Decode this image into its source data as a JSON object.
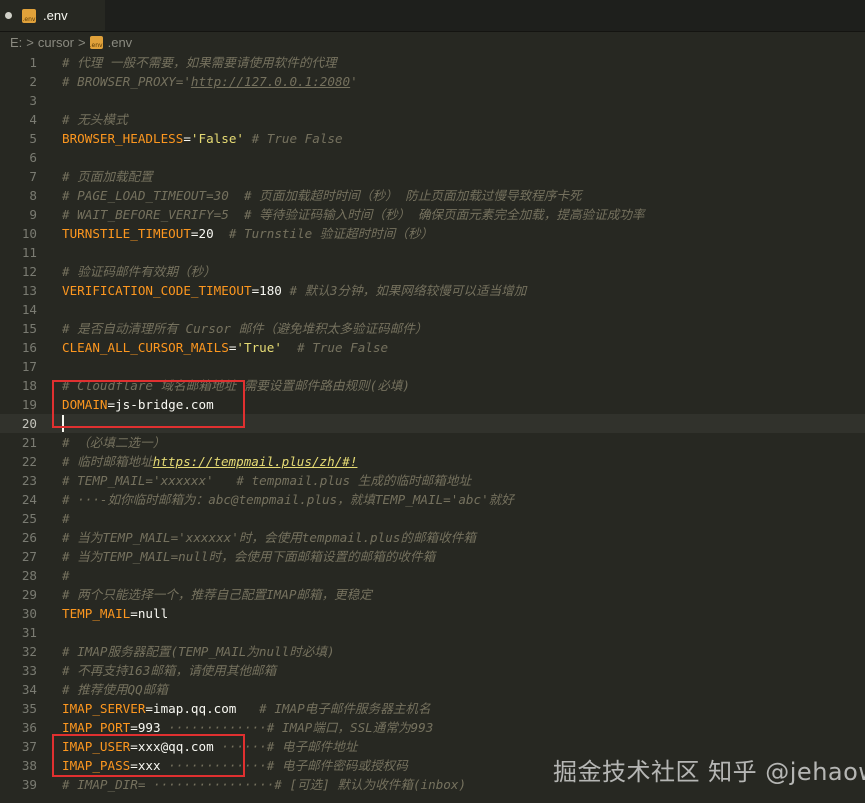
{
  "tab": {
    "label": ".env",
    "file_icon_text": ".env"
  },
  "breadcrumb": {
    "drive": "E:",
    "folder": "cursor",
    "file": ".env",
    "separator": ">"
  },
  "lines": [
    {
      "n": "1",
      "tokens": [
        {
          "t": "c",
          "v": "# 代理 一般不需要，如果需要请使用软件的代理"
        }
      ]
    },
    {
      "n": "2",
      "tokens": [
        {
          "t": "c",
          "v": "# BROWSER_PROXY='"
        },
        {
          "t": "u2",
          "v": "http://127.0.0.1:2080"
        },
        {
          "t": "c",
          "v": "'"
        }
      ]
    },
    {
      "n": "3",
      "tokens": []
    },
    {
      "n": "4",
      "tokens": [
        {
          "t": "c",
          "v": "# 无头模式"
        }
      ]
    },
    {
      "n": "5",
      "tokens": [
        {
          "t": "k",
          "v": "BROWSER_HEADLESS"
        },
        {
          "t": "o",
          "v": "="
        },
        {
          "t": "s",
          "v": "'False'"
        },
        {
          "t": "c",
          "v": " # True False"
        }
      ]
    },
    {
      "n": "6",
      "tokens": []
    },
    {
      "n": "7",
      "tokens": [
        {
          "t": "c",
          "v": "# 页面加载配置"
        }
      ]
    },
    {
      "n": "8",
      "tokens": [
        {
          "t": "c",
          "v": "# PAGE_LOAD_TIMEOUT=30  # 页面加载超时时间（秒） 防止页面加载过慢导致程序卡死"
        }
      ]
    },
    {
      "n": "9",
      "tokens": [
        {
          "t": "c",
          "v": "# WAIT_BEFORE_VERIFY=5  # 等待验证码输入时间（秒） 确保页面元素完全加载，提高验证成功率"
        }
      ]
    },
    {
      "n": "10",
      "tokens": [
        {
          "t": "k",
          "v": "TURNSTILE_TIMEOUT"
        },
        {
          "t": "o",
          "v": "=20"
        },
        {
          "t": "c",
          "v": "  # Turnstile 验证超时时间（秒）"
        }
      ]
    },
    {
      "n": "11",
      "tokens": []
    },
    {
      "n": "12",
      "tokens": [
        {
          "t": "c",
          "v": "# 验证码邮件有效期（秒）"
        }
      ]
    },
    {
      "n": "13",
      "tokens": [
        {
          "t": "k",
          "v": "VERIFICATION_CODE_TIMEOUT"
        },
        {
          "t": "o",
          "v": "=180"
        },
        {
          "t": "c",
          "v": " # 默认3分钟，如果网络较慢可以适当增加"
        }
      ]
    },
    {
      "n": "14",
      "tokens": []
    },
    {
      "n": "15",
      "tokens": [
        {
          "t": "c",
          "v": "# 是否自动清理所有 Cursor 邮件（避免堆积太多验证码邮件）"
        }
      ]
    },
    {
      "n": "16",
      "tokens": [
        {
          "t": "k",
          "v": "CLEAN_ALL_CURSOR_MAILS"
        },
        {
          "t": "o",
          "v": "="
        },
        {
          "t": "s",
          "v": "'True'"
        },
        {
          "t": "c",
          "v": "  # True False"
        }
      ]
    },
    {
      "n": "17",
      "tokens": []
    },
    {
      "n": "18",
      "tokens": [
        {
          "t": "c",
          "v": "# Cloudflare 域名邮箱地址 需要设置邮件路由规则(必填)"
        }
      ]
    },
    {
      "n": "19",
      "tokens": [
        {
          "t": "k",
          "v": "DOMAIN"
        },
        {
          "t": "o",
          "v": "=js-bridge.com"
        }
      ]
    },
    {
      "n": "20",
      "tokens": [],
      "active": true
    },
    {
      "n": "21",
      "tokens": [
        {
          "t": "c",
          "v": "# （必填二选一）"
        }
      ]
    },
    {
      "n": "22",
      "tokens": [
        {
          "t": "c",
          "v": "# 临时邮箱地址"
        },
        {
          "t": "u",
          "v": "https://tempmail.plus/zh/#!"
        }
      ]
    },
    {
      "n": "23",
      "tokens": [
        {
          "t": "c",
          "v": "# TEMP_MAIL='xxxxxx'   # tempmail.plus 生成的临时邮箱地址"
        }
      ]
    },
    {
      "n": "24",
      "tokens": [
        {
          "t": "c",
          "v": "# ···-如你临时邮箱为：abc@tempmail.plus，就填TEMP_MAIL='abc'就好"
        }
      ]
    },
    {
      "n": "25",
      "tokens": [
        {
          "t": "c",
          "v": "#"
        }
      ]
    },
    {
      "n": "26",
      "tokens": [
        {
          "t": "c",
          "v": "# 当为TEMP_MAIL='xxxxxx'时，会使用tempmail.plus的邮箱收件箱"
        }
      ]
    },
    {
      "n": "27",
      "tokens": [
        {
          "t": "c",
          "v": "# 当为TEMP_MAIL=null时，会使用下面邮箱设置的邮箱的收件箱"
        }
      ]
    },
    {
      "n": "28",
      "tokens": [
        {
          "t": "c",
          "v": "#"
        }
      ]
    },
    {
      "n": "29",
      "tokens": [
        {
          "t": "c",
          "v": "# 两个只能选择一个，推荐自己配置IMAP邮箱，更稳定"
        }
      ]
    },
    {
      "n": "30",
      "tokens": [
        {
          "t": "k",
          "v": "TEMP_MAIL"
        },
        {
          "t": "o",
          "v": "=null"
        }
      ]
    },
    {
      "n": "31",
      "tokens": []
    },
    {
      "n": "32",
      "tokens": [
        {
          "t": "c",
          "v": "# IMAP服务器配置(TEMP_MAIL为null时必填)"
        }
      ]
    },
    {
      "n": "33",
      "tokens": [
        {
          "t": "c",
          "v": "# 不再支持163邮箱，请使用其他邮箱"
        }
      ]
    },
    {
      "n": "34",
      "tokens": [
        {
          "t": "c",
          "v": "# 推荐使用QQ邮箱"
        }
      ]
    },
    {
      "n": "35",
      "tokens": [
        {
          "t": "k",
          "v": "IMAP_SERVER"
        },
        {
          "t": "o",
          "v": "=imap.qq.com"
        },
        {
          "t": "c",
          "v": "   # IMAP电子邮件服务器主机名"
        }
      ]
    },
    {
      "n": "36",
      "tokens": [
        {
          "t": "k",
          "v": "IMAP_PORT"
        },
        {
          "t": "o",
          "v": "=993"
        },
        {
          "t": "c",
          "v": " ·············# IMAP端口，SSL通常为993"
        }
      ]
    },
    {
      "n": "37",
      "tokens": [
        {
          "t": "k",
          "v": "IMAP_USER"
        },
        {
          "t": "o",
          "v": "=xxx@qq.com"
        },
        {
          "t": "c",
          "v": " ······# 电子邮件地址"
        }
      ]
    },
    {
      "n": "38",
      "tokens": [
        {
          "t": "k",
          "v": "IMAP_PASS"
        },
        {
          "t": "o",
          "v": "=xxx"
        },
        {
          "t": "c",
          "v": " ·············# 电子邮件密码或授权码"
        }
      ]
    },
    {
      "n": "39",
      "tokens": [
        {
          "t": "c",
          "v": "# IMAP_DIR= ················# [可选] 默认为收件箱(inbox)"
        }
      ]
    }
  ],
  "watermark": "掘金技术社区 知乎 @jehaowu"
}
